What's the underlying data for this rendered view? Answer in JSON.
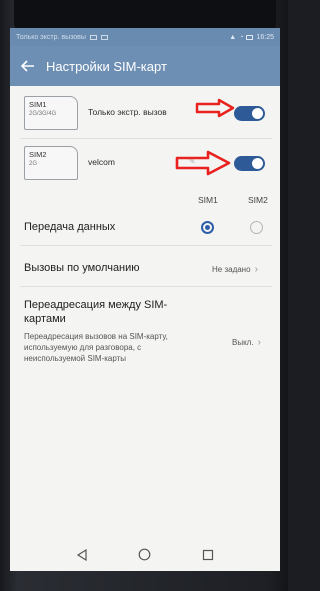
{
  "status_bar": {
    "carrier_text": "Только экстр. вызовы",
    "time": "16:25"
  },
  "header": {
    "title": "Настройки SIM-карт",
    "back_icon": "arrow-left-icon"
  },
  "sims": [
    {
      "name": "SIM1",
      "network": "2G/3G/4G",
      "label": "Только экстр. вызов",
      "enabled": true
    },
    {
      "name": "SIM2",
      "network": "2G",
      "label": "velcom",
      "enabled": true
    }
  ],
  "columns": {
    "sim1": "SIM1",
    "sim2": "SIM2"
  },
  "data_transfer": {
    "label": "Передача данных",
    "selected": "SIM1"
  },
  "default_calls": {
    "label": "Вызовы по умолчанию",
    "value": "Не задано"
  },
  "forwarding": {
    "title": "Переадресация между SIM-картами",
    "description": "Переадресация вызовов на SIM-карту, используемую для разговора, с неиспользуемой SIM-карты",
    "value": "Выкл."
  },
  "colors": {
    "accent": "#2e5a98",
    "header": "#6e8fb4",
    "annotation": "#e8221e"
  },
  "nav": {
    "back": "nav-back-icon",
    "home": "nav-home-icon",
    "recents": "nav-recents-icon"
  }
}
